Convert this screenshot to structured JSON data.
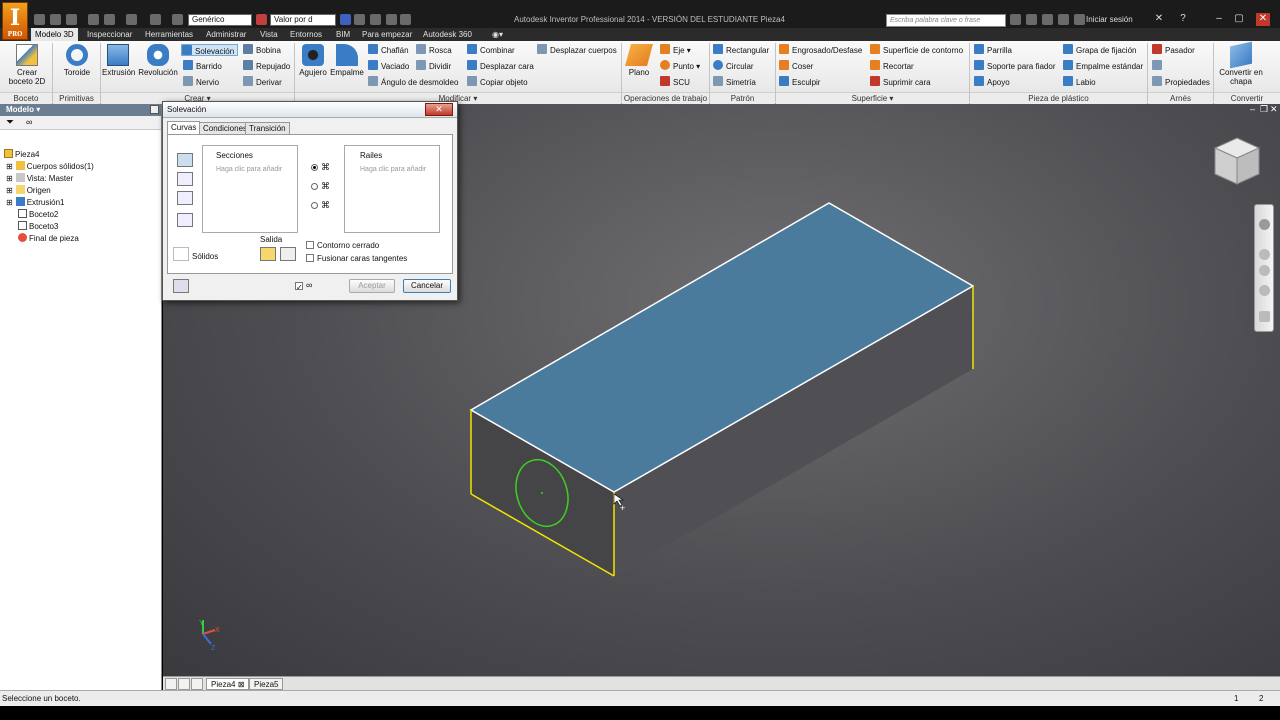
{
  "title_bar": {
    "window_title": "Autodesk Inventor Professional 2014 - VERSIÓN DEL ESTUDIANTE   Pieza4",
    "logo_letter": "I",
    "logo_badge": "PRO",
    "material_combo": "Genérico",
    "appearance_combo": "Valor por d",
    "search_placeholder": "Escriba palabra clave o frase",
    "signin_label": "Iniciar sesión",
    "help_label": "?"
  },
  "tabs": [
    {
      "label": "Modelo 3D",
      "active": true
    },
    {
      "label": "Inspeccionar"
    },
    {
      "label": "Herramientas"
    },
    {
      "label": "Administrar"
    },
    {
      "label": "Vista"
    },
    {
      "label": "Entornos"
    },
    {
      "label": "BIM"
    },
    {
      "label": "Para empezar"
    },
    {
      "label": "Autodesk 360"
    }
  ],
  "ribbon": {
    "crear_boceto": "Crear\nboceto 2D",
    "toroide": "Toroide",
    "extrusion": "Extrusión",
    "revolucion": "Revolución",
    "solevacion": "Solevación",
    "bobina": "Bobina",
    "barrido": "Barrido",
    "repujado": "Repujado",
    "nervio": "Nervio",
    "derivar": "Derivar",
    "agujero": "Agujero",
    "empalme": "Empalme",
    "chaflan": "Chaflán",
    "rosca": "Rosca",
    "combinar": "Combinar",
    "desplazar_cuerpos": "Desplazar cuerpos",
    "vaciado": "Vaciado",
    "dividir": "Dividir",
    "desplazar_cara": "Desplazar cara",
    "angulo_desmoldeo": "Ángulo de desmoldeo",
    "copiar_objeto": "Copiar objeto",
    "plano": "Plano",
    "eje": "Eje",
    "punto": "Punto",
    "scu": "SCU",
    "rectangular": "Rectangular",
    "circular": "Circular",
    "simetria": "Simetría",
    "engrosado": "Engrosado/Desfase",
    "coser": "Coser",
    "esculpir": "Esculpir",
    "superficie_contorno": "Superficie de contorno",
    "recortar": "Recortar",
    "suprimir_cara": "Suprimir cara",
    "parrilla": "Parrilla",
    "soporte_fiador": "Soporte para fiador",
    "apoyo": "Apoyo",
    "grapa_fijacion": "Grapa de fijación",
    "empalme_estandar": "Empalme estándar",
    "labio": "Labio",
    "pasador": "Pasador",
    "propiedades": "Propiedades",
    "convertir_chapa": "Convertir en\nchapa",
    "groups": {
      "boceto": "Boceto",
      "primitivas": "Primitivas",
      "crear": "Crear ▾",
      "modificar": "Modificar ▾",
      "operaciones": "Operaciones de trabajo",
      "patron": "Patrón",
      "superficie": "Superficie ▾",
      "plastico": "Pieza de plástico",
      "arnes": "Arnés",
      "convertir": "Convertir"
    }
  },
  "browser": {
    "header": "Modelo ▾",
    "items": [
      {
        "label": "Pieza4",
        "level": 0
      },
      {
        "label": "Cuerpos sólidos(1)",
        "level": 1
      },
      {
        "label": "Vista: Master",
        "level": 1
      },
      {
        "label": "Origen",
        "level": 1
      },
      {
        "label": "Extrusión1",
        "level": 1
      },
      {
        "label": "Boceto2",
        "level": 1
      },
      {
        "label": "Boceto3",
        "level": 1
      },
      {
        "label": "Final de pieza",
        "level": 1
      }
    ]
  },
  "dialog": {
    "title": "Solevación",
    "tabs": [
      "Curvas",
      "Condiciones",
      "Transición"
    ],
    "secciones_label": "Secciones",
    "secciones_hint": "Haga clic para añadir",
    "rails_label": "Railes",
    "rails_hint": "Haga clic para añadir",
    "salida_label": "Salida",
    "solidos_label": "Sólidos",
    "contorno_cerrado": "Contorno cerrado",
    "fusionar_caras": "Fusionar caras tangentes",
    "accept": "Aceptar",
    "cancel": "Cancelar"
  },
  "doc_tabs": [
    "Pieza4",
    "Pieza5"
  ],
  "status": {
    "message": "Seleccione un boceto.",
    "count1": "1",
    "count2": "2"
  },
  "colors": {
    "top_face": "#4a7b9d",
    "side_face": "#4b4b4e",
    "highlight_edge": "#f2e300",
    "circle": "#3cd21f"
  }
}
